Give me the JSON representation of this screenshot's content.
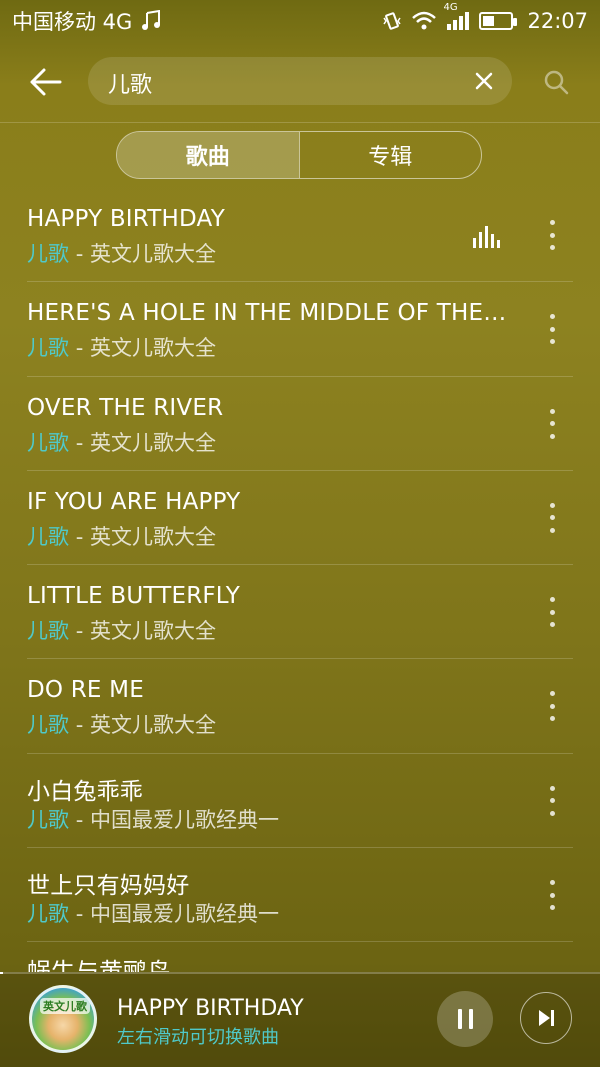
{
  "status_bar": {
    "carrier": "中国移动 4G",
    "net_label": "4G",
    "time": "22:07",
    "battery_level": 0.4
  },
  "search": {
    "query": "儿歌"
  },
  "tabs": [
    {
      "label": "歌曲",
      "active": true
    },
    {
      "label": "专辑",
      "active": false
    }
  ],
  "songs": [
    {
      "title": "HAPPY BIRTHDAY",
      "artist": "儿歌",
      "album": "- 英文儿歌大全",
      "playing": true
    },
    {
      "title": "HERE'S A HOLE IN THE MIDDLE OF THE R...",
      "artist": "儿歌",
      "album": "- 英文儿歌大全"
    },
    {
      "title": "OVER THE RIVER",
      "artist": "儿歌",
      "album": "- 英文儿歌大全"
    },
    {
      "title": "IF YOU ARE HAPPY",
      "artist": "儿歌",
      "album": "- 英文儿歌大全"
    },
    {
      "title": "LITTLE BUTTERFLY",
      "artist": "儿歌",
      "album": "- 英文儿歌大全"
    },
    {
      "title": "DO RE ME",
      "artist": "儿歌",
      "album": "- 英文儿歌大全"
    },
    {
      "title": "小白兔乖乖",
      "artist": "儿歌",
      "album": "- 中国最爱儿歌经典一"
    },
    {
      "title": "世上只有妈妈好",
      "artist": "儿歌",
      "album": "- 中国最爱儿歌经典一"
    }
  ],
  "partial_song_title": "蜗牛与黄鹂鸟",
  "player": {
    "title": "HAPPY BIRTHDAY",
    "hint": "左右滑动可切换歌曲",
    "cover_text": "英文儿歌",
    "progress": 0.005
  }
}
